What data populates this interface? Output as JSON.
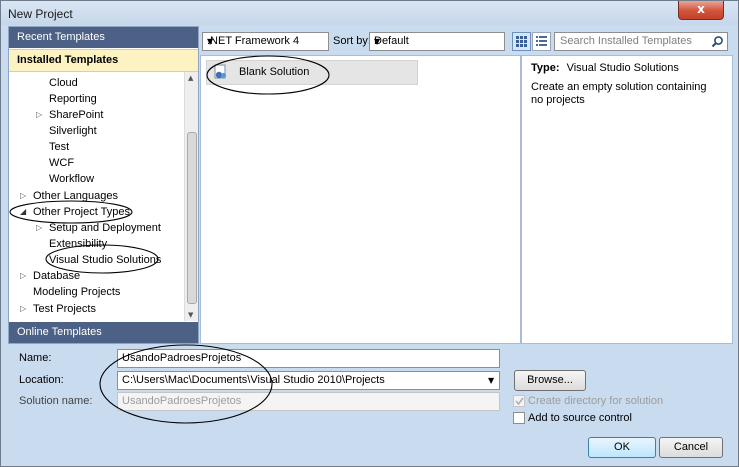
{
  "window": {
    "title": "New Project",
    "close_glyph": "x"
  },
  "left_panel": {
    "recent_templates": "Recent Templates",
    "installed_templates": "Installed Templates",
    "online_templates": "Online Templates",
    "tree": [
      "Cloud",
      "Reporting",
      "SharePoint",
      "Silverlight",
      "Test",
      "WCF",
      "Workflow",
      "Other Languages",
      "Other Project Types",
      "Setup and Deployment",
      "Extensibility",
      "Visual Studio Solutions",
      "Database",
      "Modeling Projects",
      "Test Projects"
    ]
  },
  "toolbar": {
    "framework": ".NET Framework 4",
    "sort_by_label": "Sort by:",
    "sort_value": "Default",
    "search_placeholder": "Search Installed Templates"
  },
  "templates": [
    {
      "name": "Blank Solution",
      "icon": "blank-solution-icon"
    }
  ],
  "details": {
    "type_label": "Type:",
    "type_value": "Visual Studio Solutions",
    "description": "Create an empty solution containing no projects"
  },
  "form": {
    "name_label": "Name:",
    "name_value": "UsandoPadroesProjetos",
    "location_label": "Location:",
    "location_value": "C:\\Users\\Mac\\Documents\\Visual Studio 2010\\Projects",
    "solution_name_label": "Solution name:",
    "solution_name_value": "UsandoPadroesProjetos",
    "browse": "Browse...",
    "create_directory": "Create directory for solution",
    "add_source_control": "Add to source control",
    "ok": "OK",
    "cancel": "Cancel"
  },
  "colors": {
    "dialog_bg": "#c9dbee",
    "nav_header": "#4c6185",
    "selected_header": "#fdf2c2",
    "annotation": "#000000"
  }
}
